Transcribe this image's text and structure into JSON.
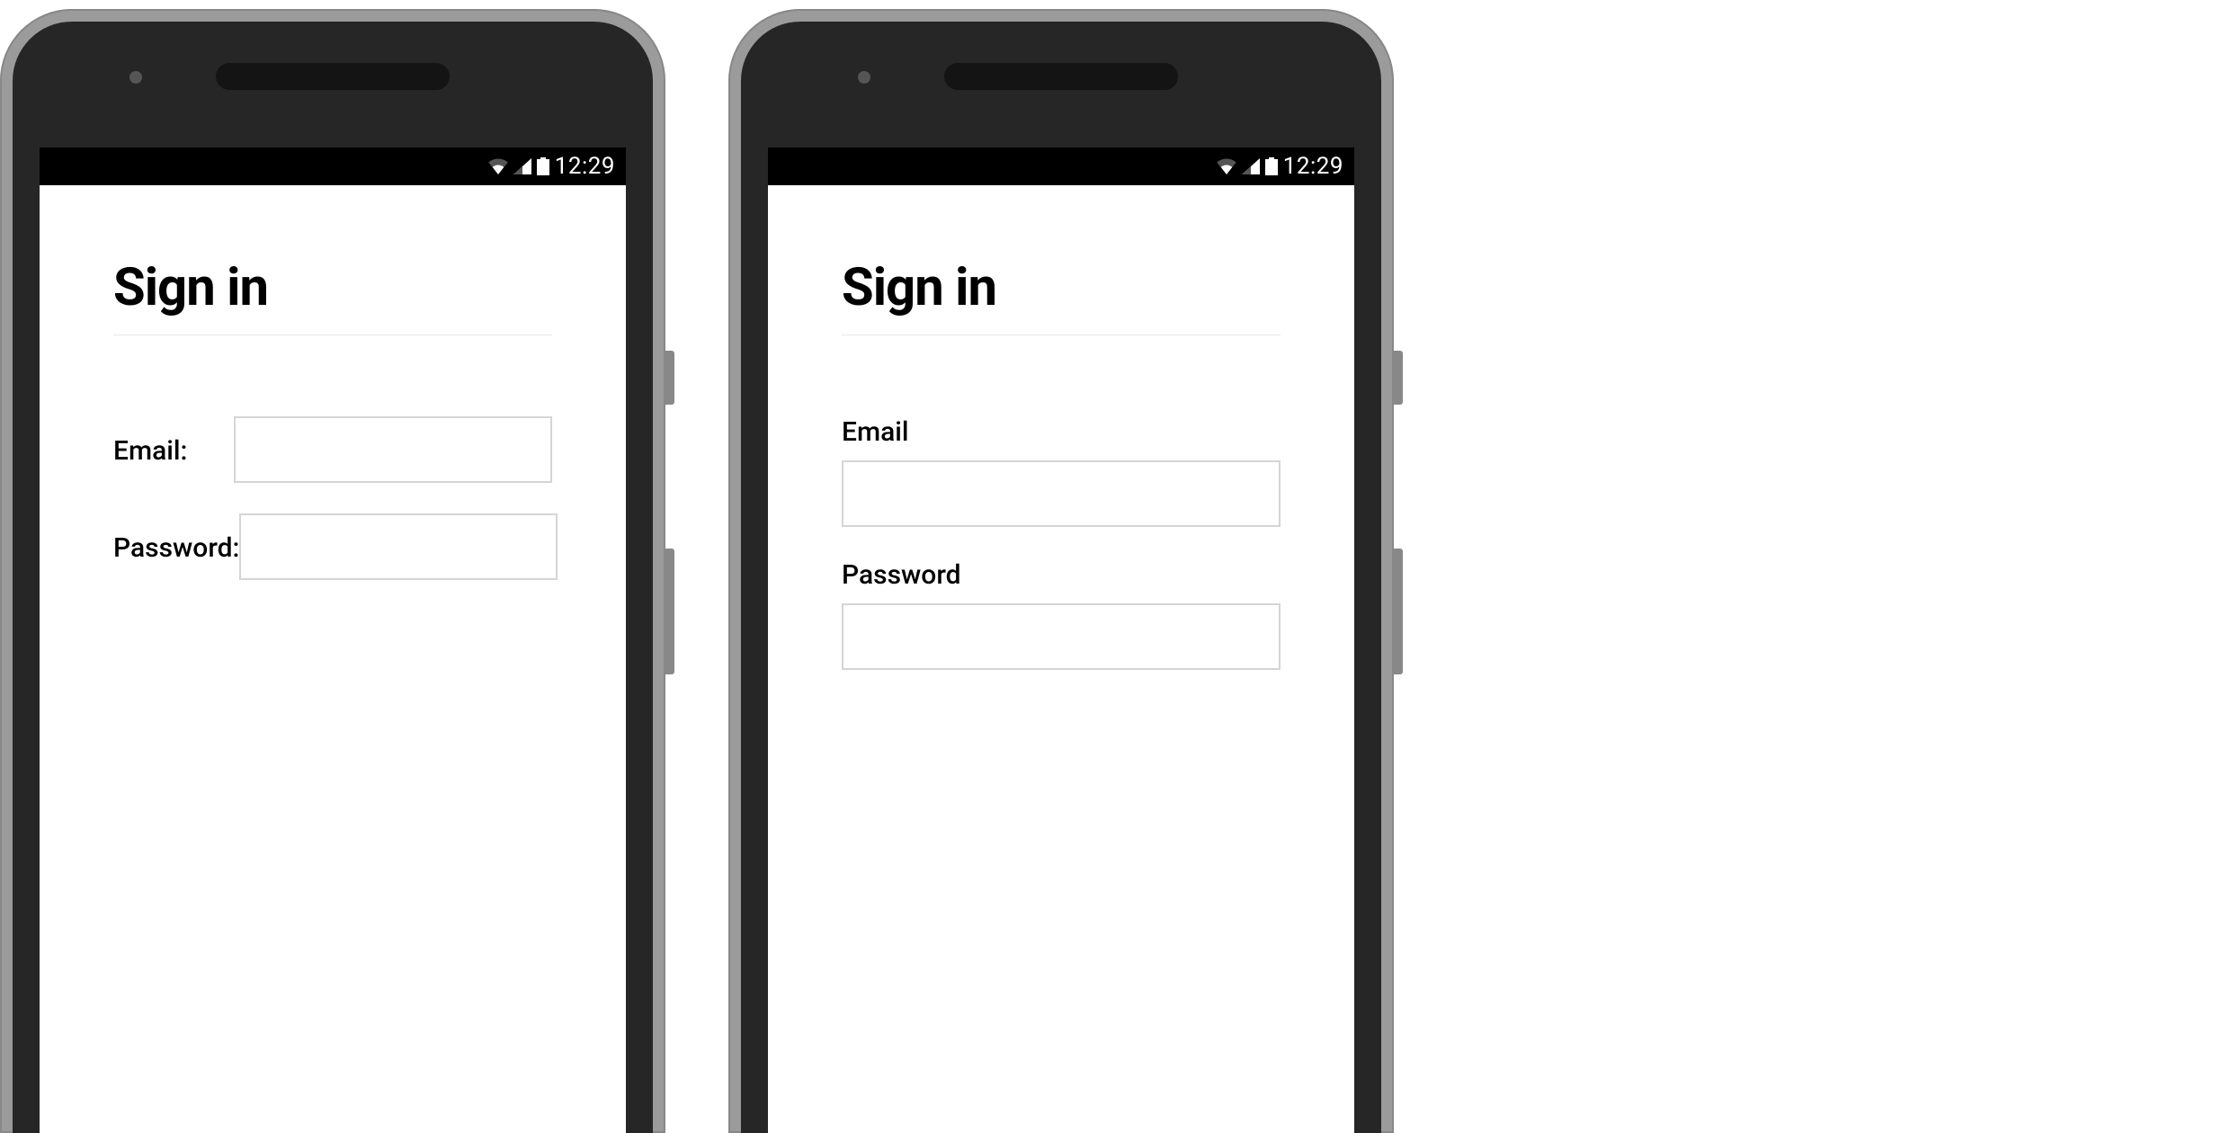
{
  "statusbar": {
    "time": "12:29"
  },
  "screen_a": {
    "title": "Sign in",
    "email_label": "Email:",
    "password_label": "Password:"
  },
  "screen_b": {
    "title": "Sign in",
    "email_label": "Email",
    "password_label": "Password"
  }
}
